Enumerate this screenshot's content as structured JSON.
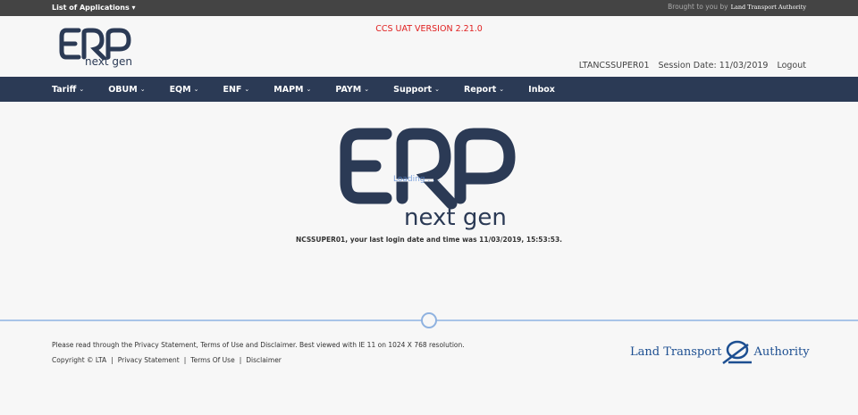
{
  "topbar": {
    "apps_label": "List of Applications ▾",
    "brought_by": "Brought to you by",
    "lta_small": "Land Transport Authority"
  },
  "header": {
    "logo_text_top": "ERP",
    "logo_text_bottom": "next gen",
    "version": "CCS UAT VERSION 2.21.0",
    "username": "LTANCSSUPER01",
    "session_date": "Session Date: 11/03/2019",
    "logout": "Logout"
  },
  "nav": [
    {
      "label": "Tariff",
      "chev": "⌄"
    },
    {
      "label": "OBUM",
      "chev": "⌄"
    },
    {
      "label": "EQM",
      "chev": "⌄"
    },
    {
      "label": "ENF",
      "chev": "⌄"
    },
    {
      "label": "MAPM",
      "chev": "⌄"
    },
    {
      "label": "PAYM",
      "chev": "⌄"
    },
    {
      "label": "Support",
      "chev": "⌄"
    },
    {
      "label": "Report",
      "chev": "⌄"
    },
    {
      "label": "Inbox",
      "chev": ""
    }
  ],
  "main": {
    "loading_text": "Loading . . .",
    "last_login": "NCSSUPER01, your last login date and time was 11/03/2019, 15:53:53."
  },
  "footer": {
    "note": "Please read through the Privacy Statement, Terms of Use and Disclaimer. Best viewed with IE 11 on 1024 X 768 resolution.",
    "copyright": "Copyright © LTA",
    "privacy": "Privacy Statement",
    "terms": "Terms Of Use",
    "disclaimer": "Disclaimer",
    "lta_left": "Land Transport",
    "lta_right": "Authority"
  },
  "colors": {
    "navbar": "#2b3a55",
    "version_red": "#e02020",
    "lta_blue": "#1d4f91"
  }
}
